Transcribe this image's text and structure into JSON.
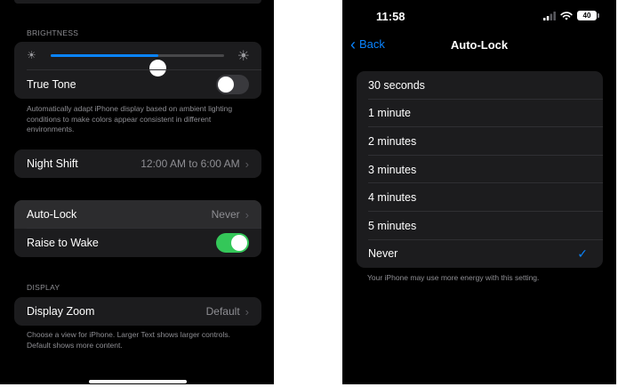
{
  "left": {
    "brightness": {
      "header": "BRIGHTNESS",
      "level": 0.62,
      "true_tone_label": "True Tone",
      "true_tone_on": false,
      "true_tone_footer": "Automatically adapt iPhone display based on ambient lighting conditions to make colors appear consistent in different environments."
    },
    "night_shift": {
      "label": "Night Shift",
      "value": "12:00 AM to 6:00 AM"
    },
    "auto_lock": {
      "label": "Auto-Lock",
      "value": "Never"
    },
    "raise_to_wake": {
      "label": "Raise to Wake",
      "on": true
    },
    "display": {
      "header": "DISPLAY",
      "zoom_label": "Display Zoom",
      "zoom_value": "Default",
      "footer": "Choose a view for iPhone. Larger Text shows larger controls. Default shows more content."
    }
  },
  "right": {
    "status": {
      "time": "11:58",
      "battery": "40"
    },
    "nav": {
      "back_label": "Back",
      "title": "Auto-Lock"
    },
    "options": [
      "30 seconds",
      "1 minute",
      "2 minutes",
      "3 minutes",
      "4 minutes",
      "5 minutes",
      "Never"
    ],
    "selected_index": 6,
    "footer": "Your iPhone may use more energy with this setting."
  },
  "colors": {
    "accent": "#0a84ff",
    "toggle_on": "#34c759",
    "background": "#000000",
    "card": "#1c1c1e"
  }
}
